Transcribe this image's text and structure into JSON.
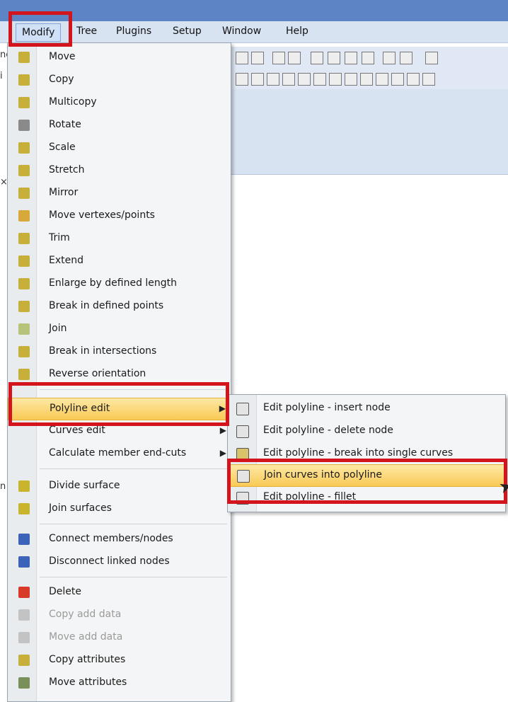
{
  "menubar": {
    "items": [
      "Modify",
      "Tree",
      "Plugins",
      "Setup",
      "Window",
      "Help"
    ],
    "active": "Modify"
  },
  "left_stubs": [
    "ne",
    "i",
    "×",
    "n"
  ],
  "menu": {
    "items": [
      {
        "label": "Move",
        "icon": "move-icon"
      },
      {
        "label": "Copy",
        "icon": "copy-icon"
      },
      {
        "label": "Multicopy",
        "icon": "multicopy-icon"
      },
      {
        "label": "Rotate",
        "icon": "rotate-icon"
      },
      {
        "label": "Scale",
        "icon": "scale-icon"
      },
      {
        "label": "Stretch",
        "icon": "stretch-icon"
      },
      {
        "label": "Mirror",
        "icon": "mirror-icon"
      },
      {
        "label": "Move vertexes/points",
        "icon": "move-vertexes-icon"
      },
      {
        "label": "Trim",
        "icon": "trim-icon"
      },
      {
        "label": "Extend",
        "icon": "extend-icon"
      },
      {
        "label": "Enlarge by defined length",
        "icon": "enlarge-icon"
      },
      {
        "label": "Break in defined points",
        "icon": "break-points-icon"
      },
      {
        "label": "Join",
        "icon": "join-icon"
      },
      {
        "label": "Break in intersections",
        "icon": "break-intersections-icon"
      },
      {
        "label": "Reverse orientation",
        "icon": "reverse-orientation-icon"
      },
      {
        "label": "Polyline edit",
        "submenu": true
      },
      {
        "label": "Curves edit",
        "submenu": true
      },
      {
        "label": "Calculate member end-cuts",
        "submenu": true
      },
      {
        "label": "Divide surface",
        "icon": "divide-surface-icon"
      },
      {
        "label": "Join surfaces",
        "icon": "join-surfaces-icon"
      },
      {
        "label": "Connect members/nodes",
        "icon": "connect-members-icon"
      },
      {
        "label": "Disconnect linked nodes",
        "icon": "disconnect-nodes-icon"
      },
      {
        "label": "Delete",
        "icon": "delete-icon"
      },
      {
        "label": "Copy add data",
        "icon": "copy-add-data-icon",
        "disabled": true
      },
      {
        "label": "Move add data",
        "icon": "move-add-data-icon",
        "disabled": true
      },
      {
        "label": "Copy attributes",
        "icon": "copy-attributes-icon"
      },
      {
        "label": "Move attributes",
        "icon": "move-attributes-icon"
      }
    ],
    "highlighted": "Polyline edit"
  },
  "submenu": {
    "items": [
      {
        "label": "Edit polyline - insert node",
        "icon": "insert-node-icon"
      },
      {
        "label": "Edit polyline - delete node",
        "icon": "delete-node-icon"
      },
      {
        "label": "Edit polyline - break into single curves",
        "icon": "break-single-curves-icon"
      },
      {
        "label": "Join curves into polyline",
        "icon": "join-curves-polyline-icon"
      },
      {
        "label": "Edit polyline - fillet",
        "icon": "fillet-icon"
      }
    ],
    "highlighted": "Join curves into polyline"
  },
  "colors": {
    "highlight_border": "#d4141c",
    "menu_hover": "#f9c955",
    "titlebar": "#5d84c4"
  }
}
